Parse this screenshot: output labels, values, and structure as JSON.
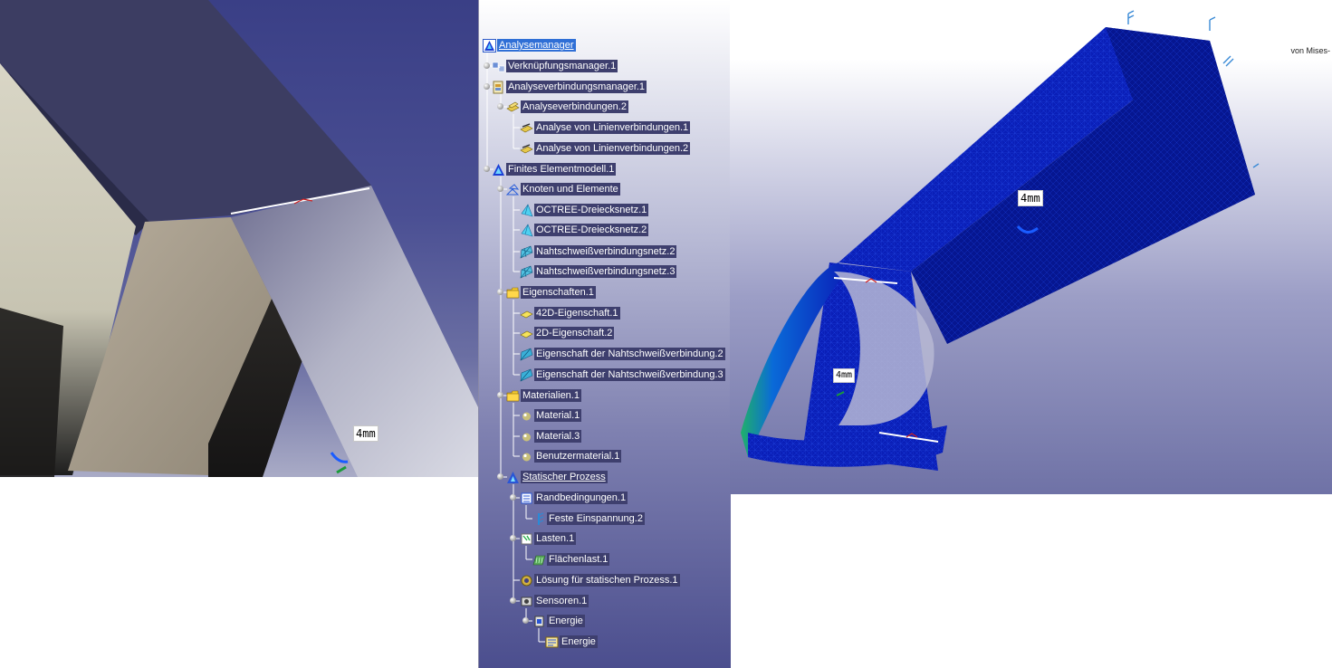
{
  "left_viewport": {
    "dimension_label": "4mm"
  },
  "tree": {
    "root": "Analysemanager",
    "items": [
      {
        "label": "Verknüpfungsmanager.1",
        "icon": "link-manager-icon"
      },
      {
        "label": "Analyseverbindungsmanager.1",
        "icon": "connection-manager-icon"
      },
      {
        "label": "Analyseverbindungen.2",
        "icon": "connections-icon"
      },
      {
        "label": "Analyse von Linienverbindungen.1",
        "icon": "line-connection-icon"
      },
      {
        "label": "Analyse von Linienverbindungen.2",
        "icon": "line-connection-icon"
      },
      {
        "label": "Finites Elementmodell.1",
        "icon": "fem-model-icon"
      },
      {
        "label": "Knoten und Elemente",
        "icon": "nodes-elements-icon"
      },
      {
        "label": "OCTREE-Dreiecksnetz.1",
        "icon": "triangle-mesh-icon"
      },
      {
        "label": "OCTREE-Dreiecksnetz.2",
        "icon": "triangle-mesh-icon"
      },
      {
        "label": "Nahtschweißverbindungsnetz.2",
        "icon": "seam-weld-mesh-icon"
      },
      {
        "label": "Nahtschweißverbindungsnetz.3",
        "icon": "seam-weld-mesh-icon"
      },
      {
        "label": "Eigenschaften.1",
        "icon": "folder-icon"
      },
      {
        "label": "42D-Eigenschaft.1",
        "icon": "property-2d-icon"
      },
      {
        "label": "2D-Eigenschaft.2",
        "icon": "property-2d-icon"
      },
      {
        "label": "Eigenschaft der Nahtschweißverbindung.2",
        "icon": "weld-property-icon"
      },
      {
        "label": "Eigenschaft der Nahtschweißverbindung.3",
        "icon": "weld-property-icon"
      },
      {
        "label": "Materialien.1",
        "icon": "folder-icon"
      },
      {
        "label": "Material.1",
        "icon": "material-icon"
      },
      {
        "label": "Material.3",
        "icon": "material-icon"
      },
      {
        "label": "Benutzermaterial.1",
        "icon": "material-icon"
      },
      {
        "label": "Statischer Prozess",
        "icon": "static-case-icon"
      },
      {
        "label": "Randbedingungen.1",
        "icon": "restraints-icon"
      },
      {
        "label": "Feste Einspannung.2",
        "icon": "clamp-icon"
      },
      {
        "label": "Lasten.1",
        "icon": "loads-icon"
      },
      {
        "label": "Flächenlast.1",
        "icon": "surface-load-icon"
      },
      {
        "label": "Lösung für statischen Prozess.1",
        "icon": "solution-icon"
      },
      {
        "label": "Sensoren.1",
        "icon": "sensors-icon"
      },
      {
        "label": "Energie",
        "icon": "energy-sensor-icon"
      },
      {
        "label": "Energie",
        "icon": "energy-result-icon"
      }
    ]
  },
  "right_viewport": {
    "dimension_label_top": "4mm",
    "dimension_label_bottom": "4mm",
    "legend_title": "von Mises-"
  },
  "colors": {
    "tree_label_bg": "#3e3f6e",
    "selected_bg": "#2f6fd6",
    "mesh_blue": "#0a1fb8",
    "mesh_green": "#1fb06b"
  }
}
